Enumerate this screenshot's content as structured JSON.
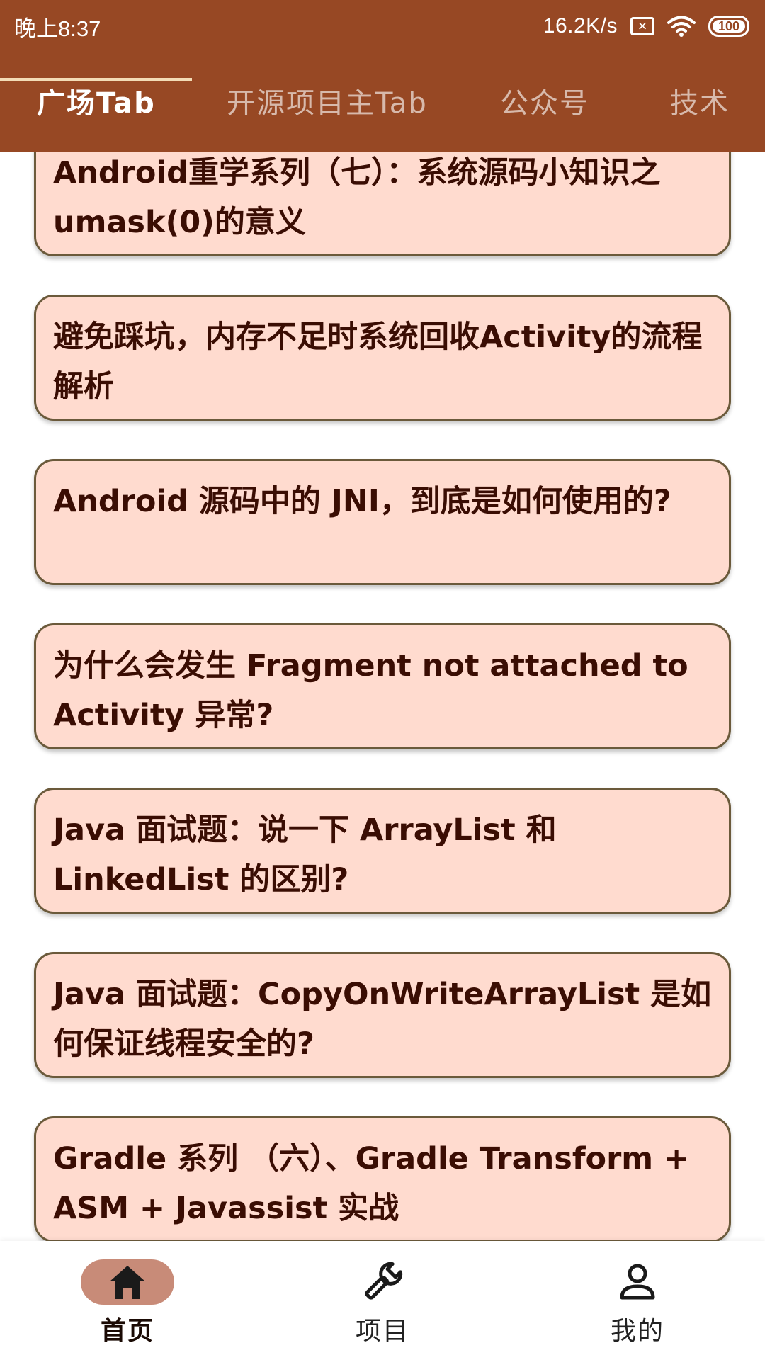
{
  "status_bar": {
    "time": "晚上8:37",
    "net_speed": "16.2K/s",
    "icons": [
      "sim-disabled-icon",
      "wifi-icon",
      "battery-icon"
    ],
    "battery": "100"
  },
  "tabs": [
    {
      "label": "广场Tab",
      "active": true
    },
    {
      "label": "开源项目主Tab",
      "active": false
    },
    {
      "label": "公众号",
      "active": false
    },
    {
      "label": "技术",
      "active": false
    }
  ],
  "articles": [
    {
      "title": "Android重学系列（七）：系统源码小知识之umask(0)的意义"
    },
    {
      "title": "避免踩坑，内存不足时系统回收Activity的流程解析"
    },
    {
      "title": "Android 源码中的 JNI，到底是如何使用的?"
    },
    {
      "title": "为什么会发生 Fragment not attached to Activity 异常?"
    },
    {
      "title": "Java 面试题：说一下 ArrayList 和 LinkedList 的区别?"
    },
    {
      "title": "Java 面试题：CopyOnWriteArrayList 是如何保证线程安全的?"
    },
    {
      "title": "Gradle 系列 （六）、Gradle Transform + ASM + Javassist 实战"
    }
  ],
  "bottom_nav": [
    {
      "label": "首页",
      "icon": "home-icon",
      "active": true
    },
    {
      "label": "项目",
      "icon": "wrench-icon",
      "active": false
    },
    {
      "label": "我的",
      "icon": "person-icon",
      "active": false
    }
  ],
  "colors": {
    "app_bar": "#974824",
    "card_background": "#ffdbcf",
    "card_border": "#6b5a3b",
    "card_text": "#3a0d03",
    "tab_indicator": "#f3dcb6",
    "nav_active_pill": "#c88b78"
  }
}
